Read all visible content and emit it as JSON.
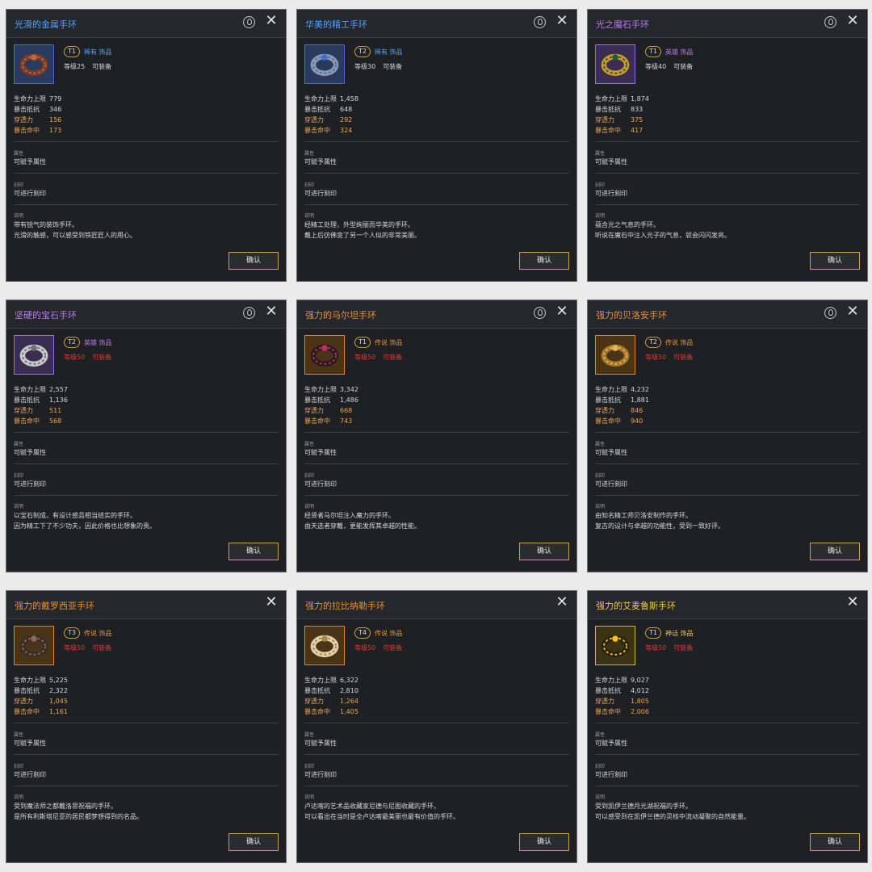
{
  "common": {
    "stat_labels": [
      "生命力上限",
      "暴击抵抗",
      "穿透力",
      "暴击命中"
    ],
    "attribute_label": "属性",
    "attribute_value": "可赋予属性",
    "engrave_label": "刻印",
    "engrave_value": "可进行刻印",
    "description_label": "说明",
    "confirm_label": "确认",
    "equippable_label": "可装备",
    "close_glyph": "✕"
  },
  "colors": {
    "rare": "#4aa3ff",
    "heroic": "#b77af0",
    "legendary": "#e8902e",
    "mythic": "#f0c93a",
    "stat_highlight": "#e8a54a",
    "level_ok": "#d6d6d6",
    "level_locked": "#e5352f"
  },
  "cards": [
    {
      "title": "光滑的金属手环",
      "tier": "T1",
      "grade": "稀有 饰品",
      "grade_key": "rare",
      "level": "等级25",
      "level_state": "ok",
      "has_locate": true,
      "icon": "bracelet-brown-metal-icon",
      "stats": [
        "779",
        "346",
        "156",
        "173"
      ],
      "description": [
        "带有锐气的装饰手环。",
        "光滑的触感，可以感受到铁匠匠人的用心。"
      ]
    },
    {
      "title": "华美的精工手环",
      "tier": "T2",
      "grade": "稀有 饰品",
      "grade_key": "rare",
      "level": "等级30",
      "level_state": "ok",
      "has_locate": true,
      "icon": "bracelet-silver-gem-icon",
      "stats": [
        "1,458",
        "648",
        "292",
        "324"
      ],
      "description": [
        "经精工处理，外型绚丽而华美的手环。",
        "戴上后彷佛变了另一个人似的非常美丽。"
      ]
    },
    {
      "title": "光之魔石手环",
      "tier": "T1",
      "grade": "英雄 饰品",
      "grade_key": "heroic",
      "level": "等级40",
      "level_state": "ok",
      "has_locate": true,
      "icon": "bracelet-gold-ring-icon",
      "stats": [
        "1,874",
        "833",
        "375",
        "417"
      ],
      "description": [
        "蕴含光之气息的手环。",
        "听说在魔石中注入光子的气息，就会闪闪发亮。"
      ]
    },
    {
      "title": "坚硬的宝石手环",
      "tier": "T2",
      "grade": "英雄 饰品",
      "grade_key": "heroic",
      "level": "等级50",
      "level_state": "locked",
      "has_locate": true,
      "icon": "bracelet-silver-chain-icon",
      "stats": [
        "2,557",
        "1,136",
        "511",
        "568"
      ],
      "description": [
        "以宝石制成，有设计感且相当结实的手环。",
        "因为精工下了不少功夫，因此价格也比想象的贵。"
      ]
    },
    {
      "title": "强力的马尔坦手环",
      "tier": "T1",
      "grade": "传说 饰品",
      "grade_key": "legendary",
      "level": "等级50",
      "level_state": "locked",
      "has_locate": true,
      "icon": "bracelet-dark-ruby-icon",
      "stats": [
        "3,342",
        "1,486",
        "668",
        "743"
      ],
      "description": [
        "经贤者马尔坦注入魔力的手环。",
        "由天选者穿戴，更能发挥其卓越的性能。"
      ]
    },
    {
      "title": "强力的贝洛安手环",
      "tier": "T2",
      "grade": "传说 饰品",
      "grade_key": "legendary",
      "level": "等级50",
      "level_state": "locked",
      "has_locate": true,
      "icon": "bracelet-gold-cuff-icon",
      "stats": [
        "4,232",
        "1,881",
        "846",
        "940"
      ],
      "description": [
        "由知名精工师贝洛安制作的手环。",
        "复古的设计与卓越的功能性，受到一致好评。"
      ]
    },
    {
      "title": "强力的戴罗西亚手环",
      "tier": "T3",
      "grade": "传说 饰品",
      "grade_key": "legendary",
      "level": "等级50",
      "level_state": "locked",
      "has_locate": false,
      "icon": "bracelet-dark-ornate-icon",
      "stats": [
        "5,225",
        "2,322",
        "1,045",
        "1,161"
      ],
      "description": [
        "受到魔法师之都戴洛思祝福的手环。",
        "是所有利斯塔尼亚的居民都梦想得到的名品。"
      ]
    },
    {
      "title": "强力的拉比纳勒手环",
      "tier": "T4",
      "grade": "传说 饰品",
      "grade_key": "legendary",
      "level": "等级50",
      "level_state": "locked",
      "has_locate": false,
      "icon": "bracelet-pale-gold-icon",
      "stats": [
        "6,322",
        "2,810",
        "1,264",
        "1,405"
      ],
      "description": [
        "卢达喀的艺术品收藏家尼德与尼图收藏的手环。",
        "可以看出在当时是全卢达喀最美丽也最有价值的手环。"
      ]
    },
    {
      "title": "强力的艾麦鲁斯手环",
      "tier": "T1",
      "grade": "神话 饰品",
      "grade_key": "mythic",
      "level": "等级50",
      "level_state": "locked",
      "has_locate": false,
      "icon": "bracelet-gold-yellow-gem-icon",
      "stats": [
        "9,027",
        "4,012",
        "1,805",
        "2,006"
      ],
      "description": [
        "受到凯伊兰德月光湖祝福的手环。",
        "可以感受到在凯伊兰德的灵核中流动凝聚的自然能量。"
      ]
    }
  ]
}
